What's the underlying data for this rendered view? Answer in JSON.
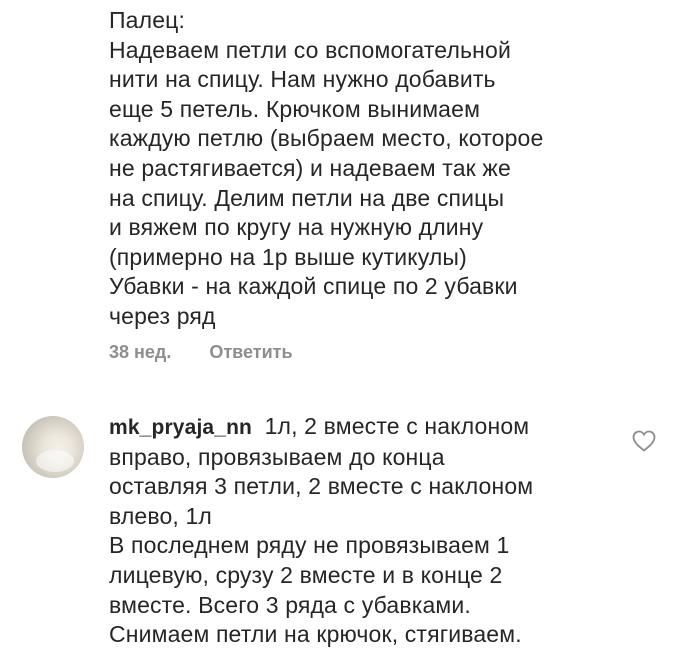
{
  "comment_top": {
    "text": "Палец:\nНадеваем петли со вспомогательной\nнити на спицу. Нам нужно добавить\nеще 5 петель. Крючком вынимаем\nкаждую петлю (выбраем место, которое\nне растягивается) и надеваем так же\nна спицу. Делим петли на две спицы\nи вяжем по кругу на нужную длину\n(примерно на 1р выше кутикулы)\nУбавки - на каждой спице по 2 убавки\nчерез ряд",
    "time": "38 нед.",
    "reply_label": "Ответить"
  },
  "comment_2": {
    "username": "mk_pryaja_nn",
    "text": "1л, 2 вместе с наклоном\nвправо, провязываем до конца\nоставляя 3 петли, 2 вместе с наклоном\nвлево, 1л\nВ последнем ряду не провязываем 1\nлицевую, срузу 2 вместе и в конце 2\nвместе. Всего 3 ряда с убавками.\nСнимаем петли на крючок, стягиваем.",
    "avatar_icon": "avatar-photo",
    "like_icon": "heart-outline-icon"
  },
  "colors": {
    "text": "#262626",
    "muted": "#8e8e8e",
    "background": "#ffffff"
  }
}
